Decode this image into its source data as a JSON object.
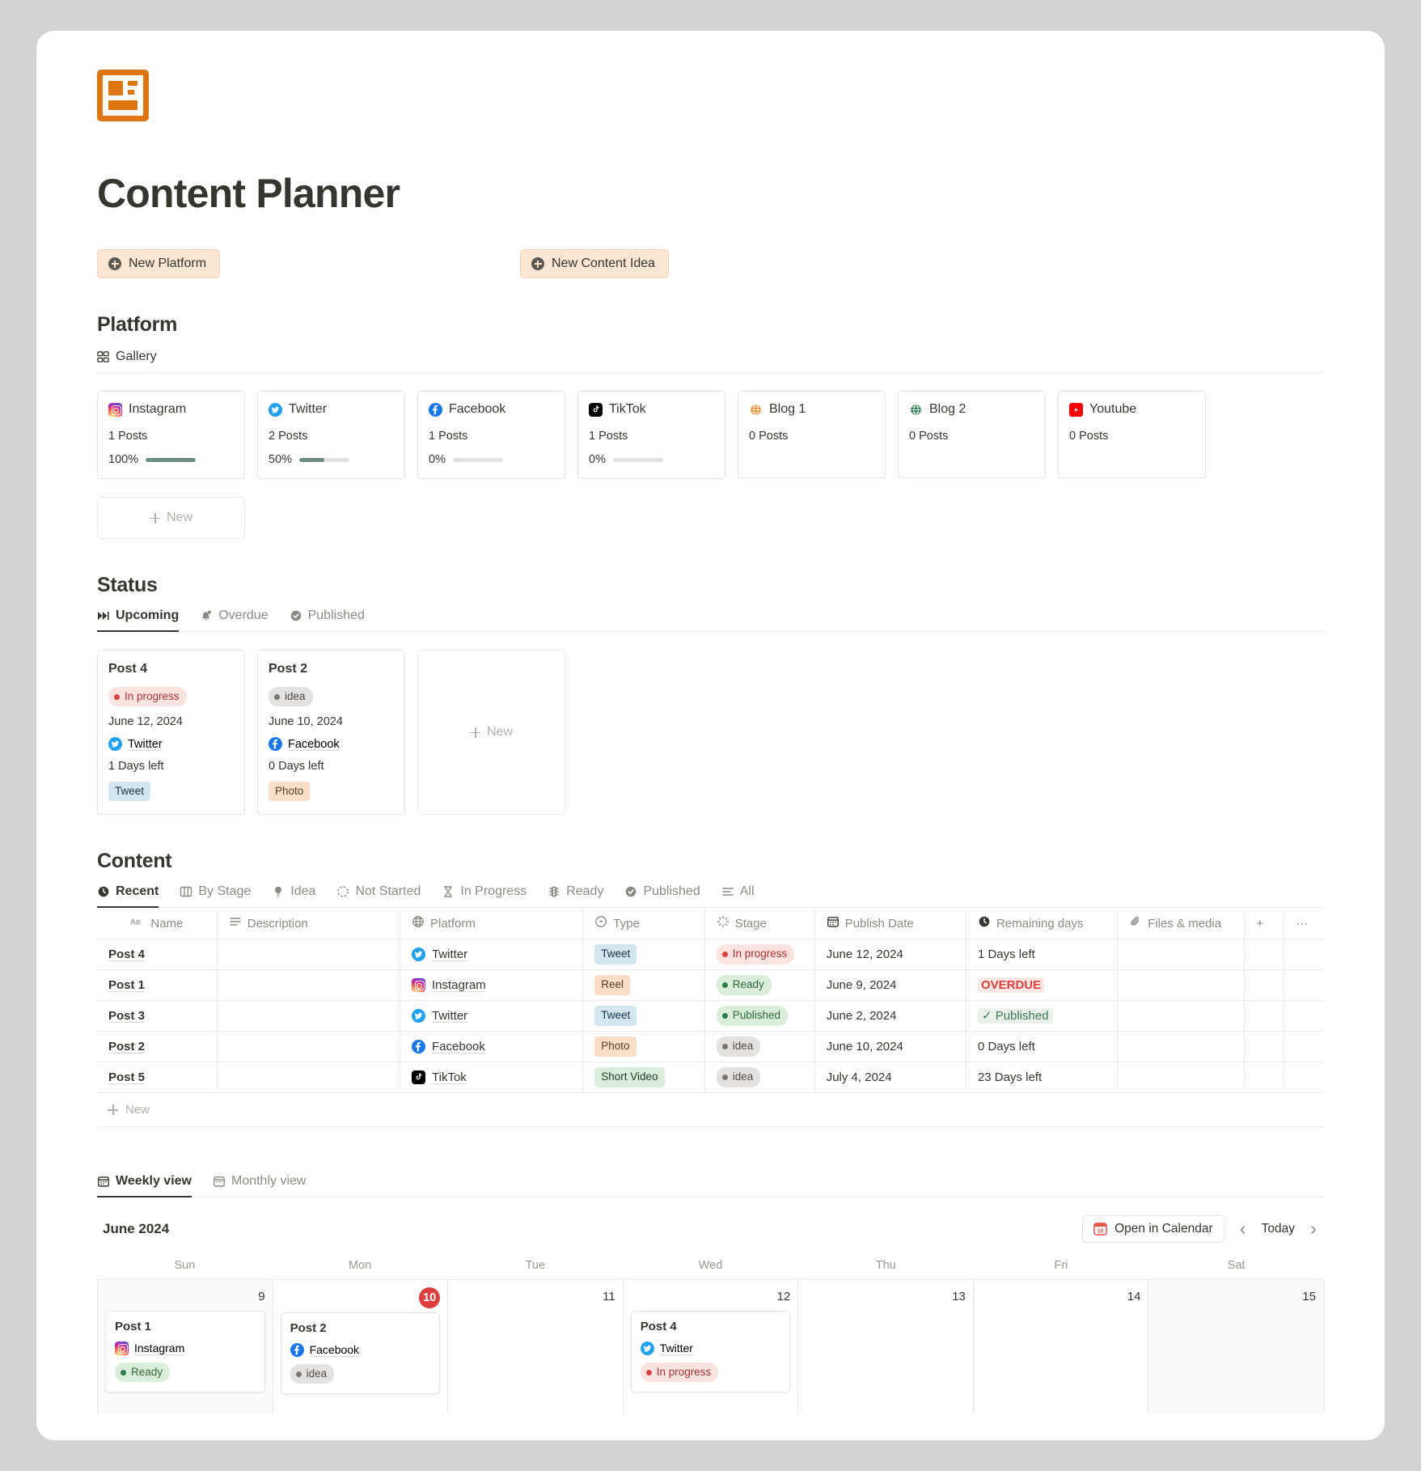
{
  "app": {
    "title": "Content Planner"
  },
  "toolbar": {
    "new_platform": "New Platform",
    "new_content_idea": "New Content Idea"
  },
  "platform_section": {
    "heading": "Platform",
    "view_label": "Gallery",
    "new_label": "New",
    "cards": [
      {
        "name": "Instagram",
        "icon": "instagram-icon",
        "posts": "1 Posts",
        "percent_label": "100%",
        "percent": 100,
        "has_bar": true
      },
      {
        "name": "Twitter",
        "icon": "twitter-icon",
        "posts": "2 Posts",
        "percent_label": "50%",
        "percent": 50,
        "has_bar": true
      },
      {
        "name": "Facebook",
        "icon": "facebook-icon",
        "posts": "1 Posts",
        "percent_label": "0%",
        "percent": 0,
        "has_bar": true
      },
      {
        "name": "TikTok",
        "icon": "tiktok-icon",
        "posts": "1 Posts",
        "percent_label": "0%",
        "percent": 0,
        "has_bar": true
      },
      {
        "name": "Blog 1",
        "icon": "globe-orange-icon",
        "posts": "0 Posts",
        "percent_label": "",
        "percent": 0,
        "has_bar": false
      },
      {
        "name": "Blog 2",
        "icon": "globe-green-icon",
        "posts": "0 Posts",
        "percent_label": "",
        "percent": 0,
        "has_bar": false
      },
      {
        "name": "Youtube",
        "icon": "youtube-icon",
        "posts": "0 Posts",
        "percent_label": "",
        "percent": 0,
        "has_bar": false
      }
    ]
  },
  "status_section": {
    "heading": "Status",
    "tabs": [
      {
        "label": "Upcoming",
        "icon": "fast-forward-icon",
        "active": true
      },
      {
        "label": "Overdue",
        "icon": "bell-icon",
        "active": false
      },
      {
        "label": "Published",
        "icon": "check-circle-icon",
        "active": false
      }
    ],
    "new_label": "New",
    "cards": [
      {
        "title": "Post 4",
        "stage": "In progress",
        "stage_class": "inprogress",
        "date": "June 12, 2024",
        "platform": "Twitter",
        "platform_icon": "twitter-icon",
        "days_left": "1 Days left",
        "type": "Tweet",
        "type_class": "tweet"
      },
      {
        "title": "Post 2",
        "stage": "idea",
        "stage_class": "idea",
        "date": "June 10, 2024",
        "platform": "Facebook",
        "platform_icon": "facebook-icon",
        "days_left": "0 Days left",
        "type": "Photo",
        "type_class": "photo"
      }
    ]
  },
  "content_section": {
    "heading": "Content",
    "tabs": [
      {
        "label": "Recent",
        "icon": "clock-icon",
        "active": true
      },
      {
        "label": "By Stage",
        "icon": "board-icon",
        "active": false
      },
      {
        "label": "Idea",
        "icon": "lightbulb-icon",
        "active": false
      },
      {
        "label": "Not Started",
        "icon": "dashed-circle-icon",
        "active": false
      },
      {
        "label": "In Progress",
        "icon": "hourglass-icon",
        "active": false
      },
      {
        "label": "Ready",
        "icon": "traffic-light-icon",
        "active": false
      },
      {
        "label": "Published",
        "icon": "check-circle-icon",
        "active": false
      },
      {
        "label": "All",
        "icon": "list-icon",
        "active": false
      }
    ],
    "columns": [
      {
        "label": "Name",
        "icon": "text-aa-icon"
      },
      {
        "label": "Description",
        "icon": "text-lines-icon"
      },
      {
        "label": "Platform",
        "icon": "globe-icon"
      },
      {
        "label": "Type",
        "icon": "select-icon"
      },
      {
        "label": "Stage",
        "icon": "status-icon"
      },
      {
        "label": "Publish Date",
        "icon": "calendar-icon"
      },
      {
        "label": "Remaining days",
        "icon": "clock-icon"
      },
      {
        "label": "Files & media",
        "icon": "paperclip-icon"
      }
    ],
    "add_column_label": "+",
    "more_label": "···",
    "new_row_label": "New",
    "rows": [
      {
        "name": "Post 4",
        "description": "",
        "platform": "Twitter",
        "platform_icon": "twitter-icon",
        "type": "Tweet",
        "type_class": "tweet",
        "stage": "In progress",
        "stage_class": "inprogress",
        "publish_date": "June 12, 2024",
        "remaining": "1 Days left",
        "remaining_style": "normal",
        "files": ""
      },
      {
        "name": "Post 1",
        "description": "",
        "platform": "Instagram",
        "platform_icon": "instagram-icon",
        "type": "Reel",
        "type_class": "reel",
        "stage": "Ready",
        "stage_class": "ready",
        "publish_date": "June 9, 2024",
        "remaining": "OVERDUE",
        "remaining_style": "overdue",
        "files": ""
      },
      {
        "name": "Post 3",
        "description": "",
        "platform": "Twitter",
        "platform_icon": "twitter-icon",
        "type": "Tweet",
        "type_class": "tweet",
        "stage": "Published",
        "stage_class": "published",
        "publish_date": "June 2, 2024",
        "remaining": "✓ Published",
        "remaining_style": "published",
        "files": ""
      },
      {
        "name": "Post 2",
        "description": "",
        "platform": "Facebook",
        "platform_icon": "facebook-icon",
        "type": "Photo",
        "type_class": "photo",
        "stage": "idea",
        "stage_class": "idea",
        "publish_date": "June 10, 2024",
        "remaining": "0 Days left",
        "remaining_style": "normal",
        "files": ""
      },
      {
        "name": "Post 5",
        "description": "",
        "platform": "TikTok",
        "platform_icon": "tiktok-icon",
        "type": "Short Video",
        "type_class": "shortvideo",
        "stage": "idea",
        "stage_class": "idea",
        "publish_date": "July 4, 2024",
        "remaining": "23 Days left",
        "remaining_style": "normal",
        "files": ""
      }
    ]
  },
  "calendar_section": {
    "tabs": [
      {
        "label": "Weekly view",
        "icon": "calendar-icon",
        "active": true
      },
      {
        "label": "Monthly view",
        "icon": "calendar-icon",
        "active": false
      }
    ],
    "month": "June 2024",
    "open_in_calendar": "Open in Calendar",
    "today_label": "Today",
    "prev_label": "‹",
    "next_label": "›",
    "day_names": [
      "Sun",
      "Mon",
      "Tue",
      "Wed",
      "Thu",
      "Fri",
      "Sat"
    ],
    "days": [
      {
        "number": "9",
        "is_today": false,
        "weekend": true,
        "events": [
          {
            "title": "Post 1",
            "platform": "Instagram",
            "platform_icon": "instagram-icon",
            "stage": "Ready",
            "stage_class": "ready"
          }
        ]
      },
      {
        "number": "10",
        "is_today": true,
        "weekend": false,
        "events": [
          {
            "title": "Post 2",
            "platform": "Facebook",
            "platform_icon": "facebook-icon",
            "stage": "idea",
            "stage_class": "idea"
          }
        ]
      },
      {
        "number": "11",
        "is_today": false,
        "weekend": false,
        "events": []
      },
      {
        "number": "12",
        "is_today": false,
        "weekend": false,
        "events": [
          {
            "title": "Post 4",
            "platform": "Twitter",
            "platform_icon": "twitter-icon",
            "stage": "In progress",
            "stage_class": "inprogress"
          }
        ]
      },
      {
        "number": "13",
        "is_today": false,
        "weekend": false,
        "events": []
      },
      {
        "number": "14",
        "is_today": false,
        "weekend": false,
        "events": []
      },
      {
        "number": "15",
        "is_today": false,
        "weekend": true,
        "events": []
      }
    ]
  },
  "colors": {
    "brand_orange": "#dd7611",
    "accent_button_bg": "#fbe6d4",
    "progress_green": "#6b9080",
    "today_red": "#e03e3e",
    "overdue_red": "#e03e3e"
  }
}
